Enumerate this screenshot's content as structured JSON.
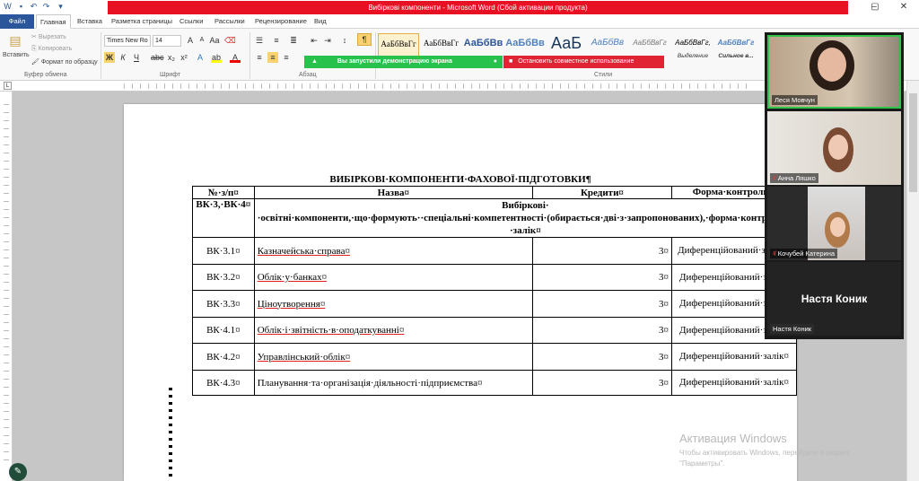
{
  "app": {
    "window_title": "Вибіркові компоненти - Microsoft Word (Сбой активации продукта)"
  },
  "tabs": [
    "Файл",
    "Главная",
    "Вставка",
    "Разметка страницы",
    "Ссылки",
    "Рассылки",
    "Рецензирование",
    "Вид"
  ],
  "ribbon": {
    "clipboard": {
      "paste": "Вставить",
      "cut": "Вырезать",
      "copy": "Копировать",
      "format_painter": "Формат по образцу",
      "label": "Буфер обмена"
    },
    "font": {
      "name": "Times New Ro",
      "size": "14",
      "label": "Шрифт"
    },
    "paragraph_label": "Абзац",
    "styles": {
      "items": [
        {
          "preview": "АаБбВвГг",
          "label": ""
        },
        {
          "preview": "АаБбВвГг",
          "label": ""
        },
        {
          "preview": "АаБбВв",
          "label": ""
        },
        {
          "preview": "АаБбВв",
          "label": ""
        },
        {
          "preview": "АаБ",
          "label": ""
        },
        {
          "preview": "АаБбВв",
          "label": ""
        },
        {
          "preview": "АаБбВвГг",
          "label": ""
        },
        {
          "preview": "АаБбВвГг,",
          "label": "Выделение"
        },
        {
          "preview": "АаБбВвГг",
          "label": "Сильное в..."
        }
      ],
      "label": "Стили"
    }
  },
  "screenshare": {
    "status": "Вы запустили демонстрацию экрана",
    "stop": "Остановить совместное использование"
  },
  "document": {
    "title": "ВИБІРКОВІ·КОМПОНЕНТИ·ФАХОВОЇ·ПІДГОТОВКИ¶",
    "headers": [
      "№·з/п¤",
      "Назва¤",
      "Кредити¤",
      "Форма·контролю¤"
    ],
    "group_row": {
      "code": "ВК·3,·ВК·4¤",
      "text": "Вибіркові· ·освітні·компоненти,·що·формують··спеціальні·компетентності·(обирається·дві·з·запропонованих),·форма·контролю·–·залік¤"
    },
    "rows": [
      {
        "code": "ВК·3.1¤",
        "name": "Казначейська·справа¤",
        "credits": "3¤",
        "control": "Диференційований·залік·¤"
      },
      {
        "code": "ВК·3.2¤",
        "name": "Облік·у·банках¤",
        "credits": "3¤",
        "control": "Диференційований·залік¤"
      },
      {
        "code": "ВК·3.3¤",
        "name": "Ціноутворення¤",
        "credits": "3¤",
        "control": "Диференційований·залік¤"
      },
      {
        "code": "ВК·4.1¤",
        "name": "Облік·і·звітність·в·оподаткуванні¤",
        "credits": "3¤",
        "control": "Диференційований·залік¤"
      },
      {
        "code": "ВК·4.2¤",
        "name": "Управлінський·облік¤",
        "credits": "3¤",
        "control": "Диференційований·залік¤"
      },
      {
        "code": "ВК·4.3¤",
        "name": "Планування·та·організація·діяльності·підприємства¤",
        "credits": "3¤",
        "control": "Диференційований·залік¤"
      }
    ]
  },
  "participants": [
    {
      "name": "Леся Мовчун",
      "muted": false
    },
    {
      "name": "Анна Ляшко",
      "muted": true
    },
    {
      "name": "Кочубей Катерина",
      "muted": true
    },
    {
      "name": "Настя Коник",
      "muted": false,
      "big_name": "Настя Коник"
    }
  ],
  "activation": {
    "title": "Активация Windows",
    "text": "Чтобы активировать Windows, перейдите в раздел \"Параметры\"."
  }
}
